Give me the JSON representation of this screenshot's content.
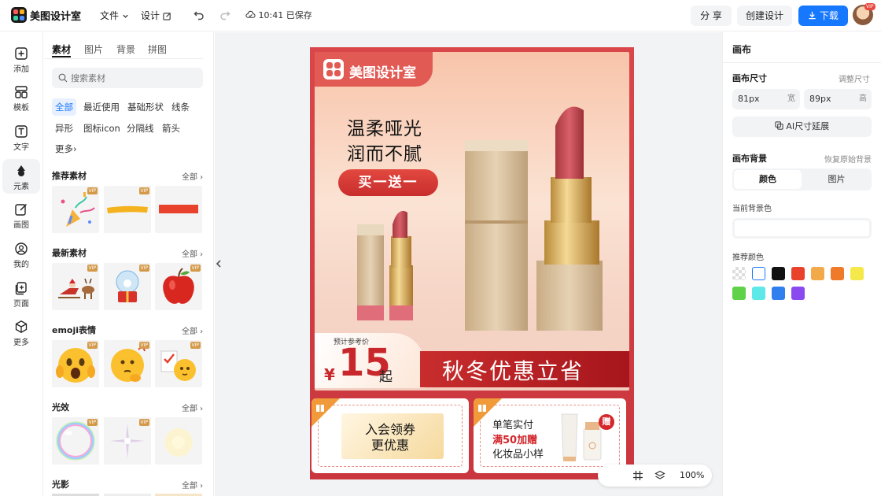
{
  "app": {
    "name": "美图设计室"
  },
  "topbar": {
    "file_menu": "文件",
    "design_menu": "设计",
    "save_status": "10:41 已保存",
    "share_label": "分 享",
    "create_label": "创建设计",
    "download_label": "下载",
    "avatar_badge": "VIP"
  },
  "rail": {
    "items": [
      {
        "label": "添加",
        "icon": "plus-square-icon"
      },
      {
        "label": "模板",
        "icon": "template-icon"
      },
      {
        "label": "文字",
        "icon": "text-icon"
      },
      {
        "label": "元素",
        "icon": "shapes-icon"
      },
      {
        "label": "画图",
        "icon": "draw-icon"
      },
      {
        "label": "我的",
        "icon": "user-icon"
      },
      {
        "label": "页面",
        "icon": "page-icon"
      },
      {
        "label": "更多",
        "icon": "cube-icon"
      }
    ],
    "active": "元素"
  },
  "panel": {
    "tabs": [
      "素材",
      "图片",
      "背景",
      "拼图"
    ],
    "search_placeholder": "搜索素材",
    "filters": [
      "全部",
      "最近使用",
      "基础形状",
      "线条",
      "异形",
      "图标icon",
      "分隔线",
      "箭头",
      "更多"
    ],
    "more_chevron": "›",
    "sections": [
      {
        "title": "推荐素材",
        "all": "全部",
        "items": [
          "party-popper",
          "yellow-brush-stroke",
          "red-bar"
        ]
      },
      {
        "title": "最新素材",
        "all": "全部",
        "items": [
          "santa-sleigh",
          "christmas-snow-globe",
          "red-apple"
        ]
      },
      {
        "title": "emoji表情",
        "all": "全部",
        "items": [
          "shocked-emoji",
          "thinking-emoji",
          "checklist-emoji"
        ]
      },
      {
        "title": "光效",
        "all": "全部",
        "items": [
          "rainbow-bubble",
          "sparkle-light",
          "soft-glow"
        ]
      },
      {
        "title": "光影",
        "all": "全部",
        "items": []
      }
    ],
    "vip_badge": "VIP"
  },
  "poster": {
    "brand": "美图设计室",
    "headline_line1": "温柔哑光",
    "headline_line2": "润而不腻",
    "promo_button": "买一送一",
    "price_caption": "预计参考价",
    "currency": "¥",
    "price": "15",
    "price_suffix": "起",
    "banner": "秋冬优惠立省",
    "coupon_line1": "入会领券",
    "coupon_line2": "更优惠",
    "gift_line1": "单笔实付",
    "gift_line2": "满50加赠",
    "gift_line3": "化妆品小样",
    "gift_badge": "赠"
  },
  "right_panel": {
    "title": "画布",
    "size_label": "画布尺寸",
    "size_action": "调整尺寸",
    "width_value": "81px",
    "width_unit": "宽",
    "height_value": "89px",
    "height_unit": "高",
    "ai_extend": "AI尺寸延展",
    "bg_label": "画布背景",
    "bg_reset": "恢复原始背景",
    "bg_tabs": [
      "颜色",
      "图片"
    ],
    "current_bg_label": "当前背景色",
    "recommend_label": "推荐颜色",
    "swatches": [
      "transparent",
      "#ffffff",
      "#111111",
      "#e8412c",
      "#f2a94a",
      "#ef7a2a",
      "#f5e84a",
      "#5fd24a",
      "#5ee8e8",
      "#2f7fef",
      "#8a4af0"
    ]
  },
  "zoom": {
    "value": "100%"
  },
  "colors": {
    "accent": "#1677ff",
    "poster_red": "#d9474a"
  }
}
